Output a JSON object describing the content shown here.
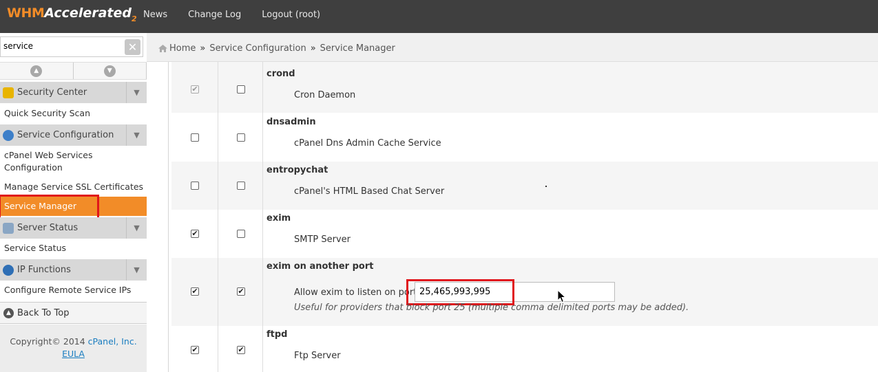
{
  "header": {
    "logo_main": "WHM",
    "logo_sub": "Accelerated",
    "logo_version": "2",
    "nav": [
      "News",
      "Change Log",
      "Logout (root)"
    ]
  },
  "sidebar": {
    "search_value": "service",
    "sections": [
      {
        "title": "Security Center",
        "icon": "lock-icon",
        "links": [
          "Quick Security Scan"
        ]
      },
      {
        "title": "Service Configuration",
        "icon": "gear-icon",
        "links": [
          "cPanel Web Services Configuration",
          "Manage Service SSL Certificates",
          "Service Manager"
        ]
      },
      {
        "title": "Server Status",
        "icon": "server-icon",
        "links": [
          "Service Status"
        ]
      },
      {
        "title": "IP Functions",
        "icon": "globe-icon",
        "links": [
          "Configure Remote Service IPs"
        ]
      }
    ],
    "active_link": "Service Manager",
    "back_to_top": "Back To Top",
    "footer": {
      "copyright": "Copyright© 2014",
      "company": "cPanel, Inc.",
      "eula": "EULA"
    }
  },
  "breadcrumb": {
    "home": "Home",
    "sep": "»",
    "level1": "Service Configuration",
    "current": "Service Manager"
  },
  "services": [
    {
      "name": "crond",
      "description": "Cron Daemon",
      "enabled": true,
      "enabled_disabled": true,
      "monitor": false
    },
    {
      "name": "dnsadmin",
      "description": "cPanel Dns Admin Cache Service",
      "enabled": false,
      "monitor": false
    },
    {
      "name": "entropychat",
      "description": "cPanel's HTML Based Chat Server",
      "enabled": false,
      "monitor": false
    },
    {
      "name": "exim",
      "description": "SMTP Server",
      "enabled": true,
      "monitor": false
    },
    {
      "name": "exim on another port",
      "description": "Allow exim to listen on port",
      "port_value": "25,465,993,995",
      "note": "Useful for providers that block port 25 (multiple comma delimited ports may be added).",
      "enabled": true,
      "monitor": true
    },
    {
      "name": "ftpd",
      "description": "Ftp Server",
      "enabled": true,
      "monitor": true
    }
  ],
  "colors": {
    "accent": "#f28c28",
    "highlight": "#e0161b",
    "topbar": "#3f3f3f"
  }
}
